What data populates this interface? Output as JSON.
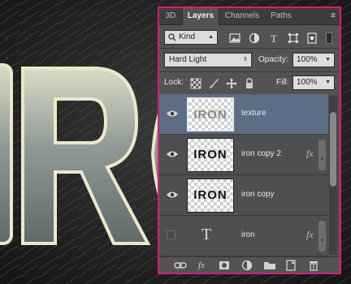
{
  "canvas": {
    "artwork_text": "IRON"
  },
  "panel": {
    "tabs": [
      {
        "label": "3D",
        "active": false
      },
      {
        "label": "Layers",
        "active": true
      },
      {
        "label": "Channels",
        "active": false
      },
      {
        "label": "Paths",
        "active": false
      }
    ],
    "filter": {
      "kind_label": "Kind",
      "icons": [
        "image-filter-icon",
        "adjustment-filter-icon",
        "type-filter-icon",
        "shape-filter-icon",
        "smart-object-filter-icon"
      ]
    },
    "blend_mode": "Hard Light",
    "opacity_label": "Opacity:",
    "opacity_value": "100%",
    "lock_label": "Lock:",
    "lock_icons": [
      "lock-transparent-icon",
      "lock-image-icon",
      "lock-position-icon",
      "lock-all-icon"
    ],
    "fill_label": "Fill:",
    "fill_value": "100%",
    "layers": [
      {
        "name": "texture",
        "thumb_text": "IRON",
        "visible": true,
        "selected": true,
        "type": "image",
        "fx": false
      },
      {
        "name": "iron copy 2",
        "thumb_text": "IRON",
        "visible": true,
        "selected": false,
        "type": "image",
        "fx": true
      },
      {
        "name": "iron copy",
        "thumb_text": "IRON",
        "visible": true,
        "selected": false,
        "type": "image",
        "fx": false
      },
      {
        "name": "iron",
        "visible": false,
        "selected": false,
        "type": "text",
        "type_glyph": "T",
        "fx": true
      }
    ],
    "fx_label": "fx",
    "bottom_buttons": [
      "link-layers-icon",
      "layer-style-icon",
      "add-mask-icon",
      "new-adjustment-icon",
      "new-group-icon",
      "new-layer-icon",
      "delete-layer-icon"
    ],
    "colors": {
      "border": "#e0197a",
      "panel_bg": "#535353",
      "selected_row": "#5b6e86"
    }
  }
}
